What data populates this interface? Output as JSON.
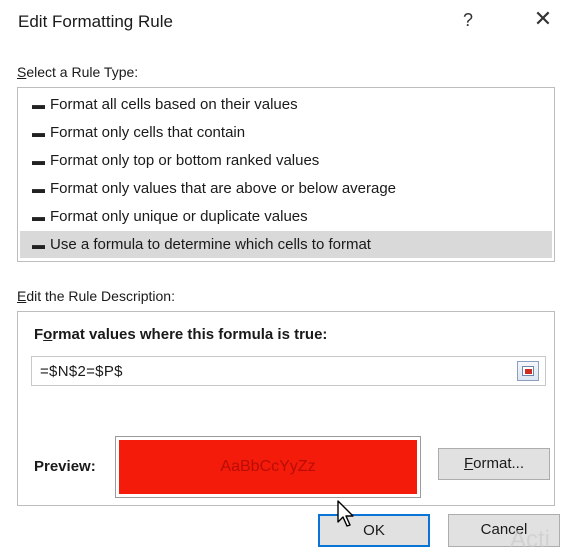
{
  "dialog": {
    "title": "Edit Formatting Rule",
    "help_label": "?",
    "close_label": "✕"
  },
  "rule_type": {
    "label_mnemonic": "S",
    "label_rest": "elect a Rule Type:",
    "items": [
      {
        "label": "Format all cells based on their values",
        "selected": false
      },
      {
        "label": "Format only cells that contain",
        "selected": false
      },
      {
        "label": "Format only top or bottom ranked values",
        "selected": false
      },
      {
        "label": "Format only values that are above or below average",
        "selected": false
      },
      {
        "label": "Format only unique or duplicate values",
        "selected": false
      },
      {
        "label": "Use a formula to determine which cells to format",
        "selected": true
      }
    ]
  },
  "rule_description": {
    "label_mnemonic": "E",
    "label_rest": "dit the Rule Description:",
    "heading_pre": "F",
    "heading_mnemonic": "o",
    "heading_rest": "rmat values where this formula is true:",
    "formula_value": "=$N$2=$P$"
  },
  "preview": {
    "label": "Preview:",
    "sample_text": "AaBbCcYyZz",
    "fill_color": "#f51b0a"
  },
  "buttons": {
    "format_mnemonic": "F",
    "format_rest": "ormat...",
    "ok_label": "OK",
    "cancel_label": "Cancel"
  },
  "watermark": "Acti"
}
